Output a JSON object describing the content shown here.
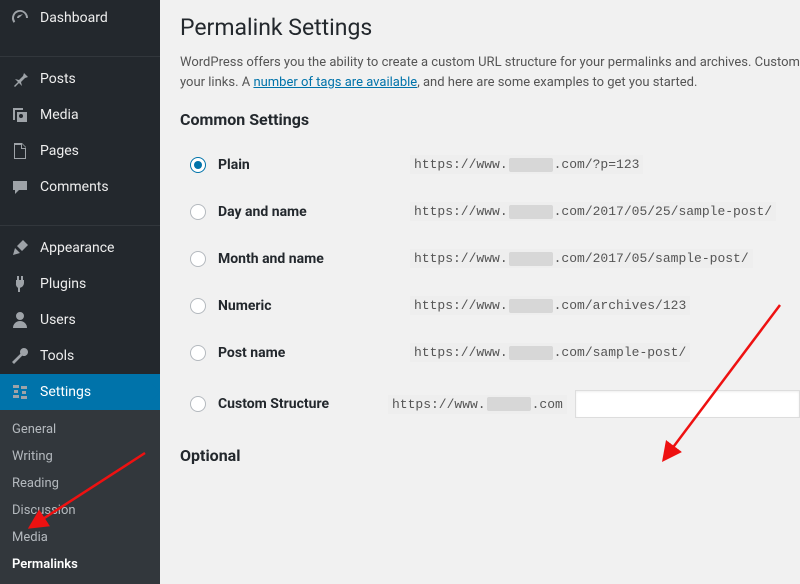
{
  "sidebar": {
    "items": [
      {
        "label": "Dashboard"
      },
      {
        "label": "Posts"
      },
      {
        "label": "Media"
      },
      {
        "label": "Pages"
      },
      {
        "label": "Comments"
      },
      {
        "label": "Appearance"
      },
      {
        "label": "Plugins"
      },
      {
        "label": "Users"
      },
      {
        "label": "Tools"
      },
      {
        "label": "Settings"
      }
    ],
    "submenu": [
      {
        "label": "General"
      },
      {
        "label": "Writing"
      },
      {
        "label": "Reading"
      },
      {
        "label": "Discussion"
      },
      {
        "label": "Media"
      },
      {
        "label": "Permalinks"
      }
    ]
  },
  "page": {
    "title": "Permalink Settings",
    "intro_1": "WordPress offers you the ability to create a custom URL structure for your permalinks and archives. Custom",
    "intro_2a": "your links. A ",
    "intro_link": "number of tags are available",
    "intro_2b": ", and here are some examples to get you started.",
    "common_heading": "Common Settings",
    "optional_heading": "Optional"
  },
  "options": {
    "plain": {
      "label": "Plain",
      "pre": "https://www.",
      "post": ".com/?p=123"
    },
    "day": {
      "label": "Day and name",
      "pre": "https://www.",
      "post": ".com/2017/05/25/sample-post/"
    },
    "month": {
      "label": "Month and name",
      "pre": "https://www.",
      "post": ".com/2017/05/sample-post/"
    },
    "numeric": {
      "label": "Numeric",
      "pre": "https://www.",
      "post": ".com/archives/123"
    },
    "postname": {
      "label": "Post name",
      "pre": "https://www.",
      "post": ".com/sample-post/"
    },
    "custom": {
      "label": "Custom Structure",
      "pre": "https://www.",
      "post": ".com"
    }
  }
}
